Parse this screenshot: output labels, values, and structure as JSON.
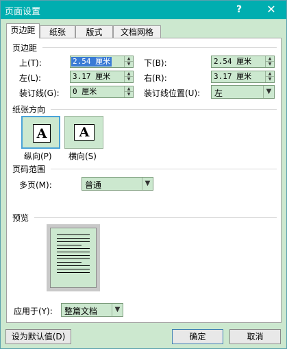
{
  "window": {
    "title": "页面设置",
    "help_label": "?",
    "close_label": "✕"
  },
  "tabs": [
    {
      "label": "页边距",
      "active": true
    },
    {
      "label": "纸张",
      "active": false
    },
    {
      "label": "版式",
      "active": false
    },
    {
      "label": "文档网格",
      "active": false
    }
  ],
  "margins": {
    "section_label": "页边距",
    "top": {
      "label": "上(T):",
      "value": "2.54 厘米"
    },
    "bottom": {
      "label": "下(B):",
      "value": "2.54 厘米"
    },
    "left": {
      "label": "左(L):",
      "value": "3.17 厘米"
    },
    "right": {
      "label": "右(R):",
      "value": "3.17 厘米"
    },
    "gutter": {
      "label": "装订线(G):",
      "value": "0 厘米"
    },
    "gutter_position": {
      "label": "装订线位置(U):",
      "value": "左"
    }
  },
  "orientation": {
    "section_label": "纸张方向",
    "icon_glyph": "A",
    "portrait_label": "纵向(P)",
    "landscape_label": "横向(S)",
    "selected": "portrait"
  },
  "pages": {
    "section_label": "页码范围",
    "multiple_label": "多页(M):",
    "multiple_value": "普通"
  },
  "preview": {
    "section_label": "预览",
    "apply_label": "应用于(Y):",
    "apply_value": "整篇文档"
  },
  "buttons": {
    "default": "设为默认值(D)",
    "ok": "确定",
    "cancel": "取消"
  },
  "colors": {
    "titlebar": "#00aeb0",
    "field_background": "#cce8cf",
    "selection": "#3a7bd5",
    "focus_border": "#4aa3d8"
  }
}
